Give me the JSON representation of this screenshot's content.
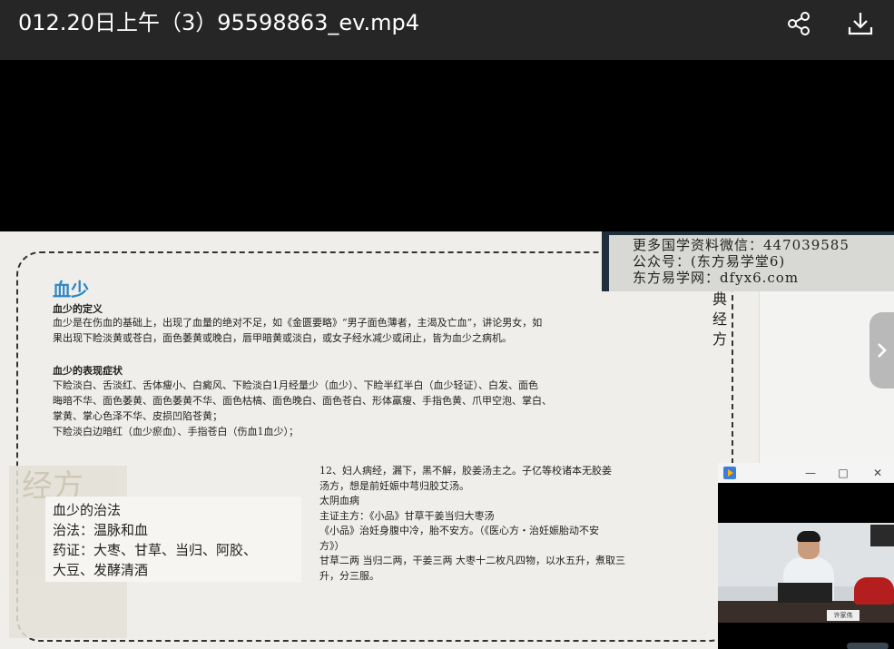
{
  "header": {
    "title": "012.20日上午（3）95598863_ev.mp4",
    "share_icon": "share-icon",
    "download_icon": "download-icon"
  },
  "slide": {
    "heading": "血少",
    "definition_title": "血少的定义",
    "definition_text": "血少是在伤血的基础上，出现了血量的绝对不足，如《金匮要略》“男子面色薄者，主渴及亡血”，讲论男女，如\n果出现下睑淡黄或苍白，面色萎黄或晚白，唇甲暗黄或淡白，或女子经水减少或闭止，皆为血少之病机。",
    "symptoms_title": "血少的表现症状",
    "symptoms_text": "下睑淡白、舌淡红、舌体瘦小、白癜风、下睑淡白1月经量少（血少）、下睑半红半白（血少轻证）、白发、面色\n晦暗不华、面色萎黄、面色萎黄不华、面色枯槁、面色晚白、面色苍白、形体羸瘦、手指色黄、爪甲空泡、掌白、\n掌黄、掌心色泽不华、皮损凹陷苍黄；\n下睑淡白边暗红（血少瘀血）、手指苍白（伤血1血少）；",
    "ghost_text": "经方",
    "treatment": {
      "title": "血少的治法",
      "method": "治法：温脉和血",
      "herbs": "药证：大枣、甘草、当归、阿胶、\n大豆、发酵清酒"
    },
    "classic_text": "      12、妇人病经，漏下，黑不解，胶姜汤主之。子亿等校诸本无胶姜\n汤方，想是前妊娠中芎归胶艾汤。\n      太阴血病\n      主证主方：《小品》甘草干姜当归大枣汤\n      《小品》治妊身腹中冷，胎不安方。（《医心方・治妊娠胎动不安\n方》）\n甘草二两  当归二两，干姜三两  大枣十二枚凡四物，以水五升，煮取三\n升，分三服。",
    "vertical_text": "典经方"
  },
  "watermark": {
    "line1": "更多国学资料微信：447039585",
    "line2": "公众号：(东方易学堂6)",
    "line3": "东方易学网：dfyx6.com"
  },
  "next_button": {
    "icon": "chevron-right-icon"
  },
  "pip": {
    "min_label": "—",
    "max_label": "□",
    "close_label": "✕",
    "name_plate": "许家伟"
  }
}
